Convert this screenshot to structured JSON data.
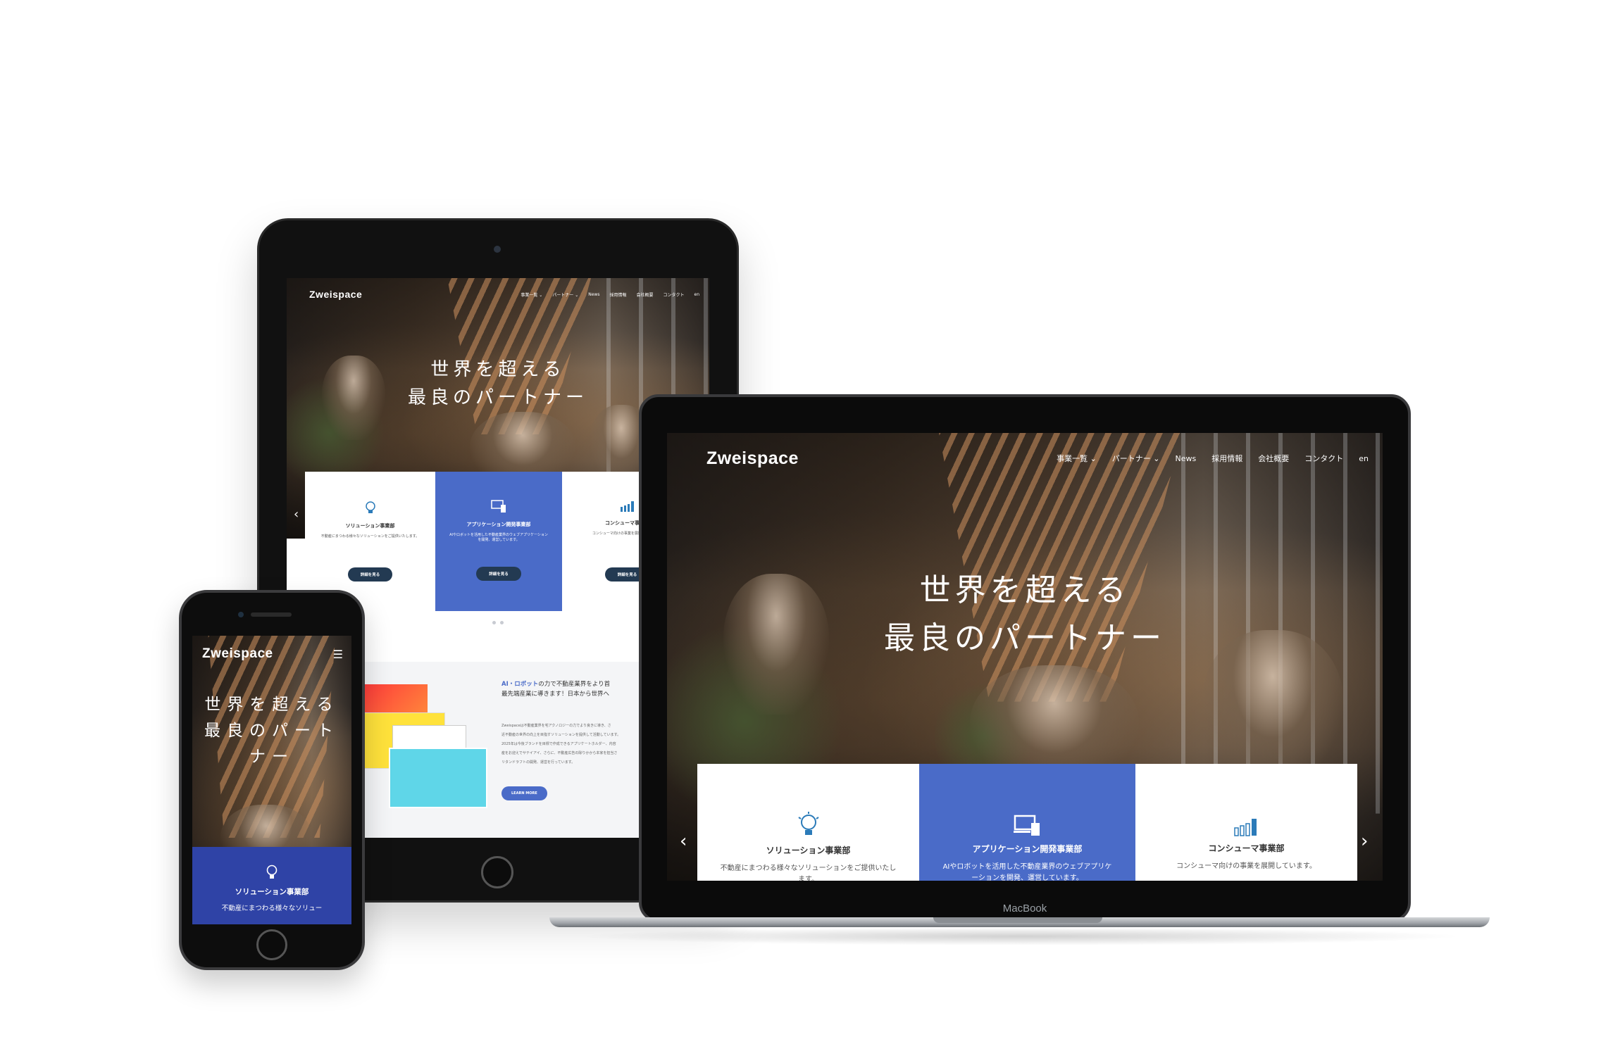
{
  "brand": {
    "logo": "Zweispace",
    "accent_blue": "#4a6bc8",
    "button_navy": "#233a52"
  },
  "nav": {
    "items": [
      "事業一覧 ⌄",
      "パートナー ⌄",
      "News",
      "採用情報",
      "会社概要",
      "コンタクト",
      "en"
    ]
  },
  "hero": {
    "line1": "世界を超える",
    "line2": "最良のパートナー"
  },
  "phone_hero": {
    "line1": "世界を超える",
    "line2": "最良のパート",
    "line3": "ナー"
  },
  "cards": [
    {
      "title": "ソリューション事業部",
      "desc": "不動産にまつわる様々なソリューションをご提供いたします。",
      "button": "詳細を見る",
      "icon": "lightbulb-icon"
    },
    {
      "title": "アプリケーション開発事業部",
      "desc": "AIやロボットを活用した不動産業界のウェブアプリケーションを開発、運営しています。",
      "button": "詳細を見る",
      "icon": "devices-icon"
    },
    {
      "title": "コンシューマ事業部",
      "desc": "コンシューマ向けの事業を展開しています。",
      "button": "詳細を見る",
      "icon": "bar-chart-icon"
    }
  ],
  "phone_card": {
    "title": "ソリューション事業部",
    "desc": "不動産にまつわる様々なソリュー"
  },
  "about": {
    "headline_strong": "AI・ロボット",
    "headline_rest": "の力で不動産業界をより首",
    "headline_line2": "最先端産業に導きます！日本から世界へ",
    "body": [
      "Zweispaceは不動産業界を宅アクノロジーの力でより良きに導き、さ",
      "近不動産の世界の向上を目指すソリューションを提供して活動しています。",
      "2025年は今後ブランドを目標で作成できるアプリケートホルダー、内容",
      "産をお迎えでサテイアイ、さらに、不動産広告の除りかから本家を担当さ",
      "リタンドラフトの開発、運営を行っています。"
    ],
    "button": "LEARN MORE"
  },
  "macbook_label": "MacBook",
  "arrows": {
    "prev": "‹",
    "next": "›"
  }
}
